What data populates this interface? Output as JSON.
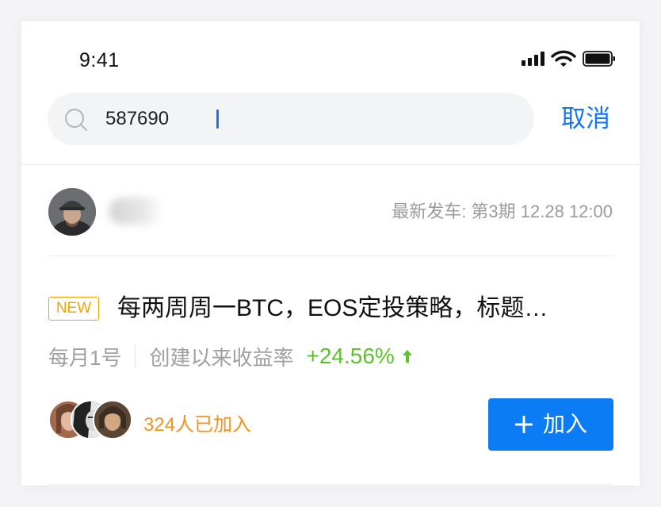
{
  "status_bar": {
    "time": "9:41",
    "icons": [
      "cellular-signal-icon",
      "wifi-icon",
      "battery-icon"
    ]
  },
  "search": {
    "query": "587690",
    "cancel_label": "取消"
  },
  "creator": {
    "avatar_icon": "user-avatar",
    "latest_label": "最新发车: 第3期 12.28 12:00"
  },
  "strategy": {
    "badge": "NEW",
    "title": "每两周周一BTC，EOS定投策略，标题…",
    "period": "每月1号",
    "return_label": "创建以来收益率",
    "return_value": "+24.56%",
    "return_trend_icon": "arrow-up-icon",
    "joined_text": "324人已加入",
    "join_label": "加入",
    "join_icon": "plus-icon"
  },
  "colors": {
    "accent_blue": "#1377f5",
    "button_blue": "#0c7cf4",
    "badge_orange": "#f5a300",
    "joined_orange": "#f59322",
    "positive_green": "#5ec02a",
    "secondary_text": "#9b9b9b"
  }
}
